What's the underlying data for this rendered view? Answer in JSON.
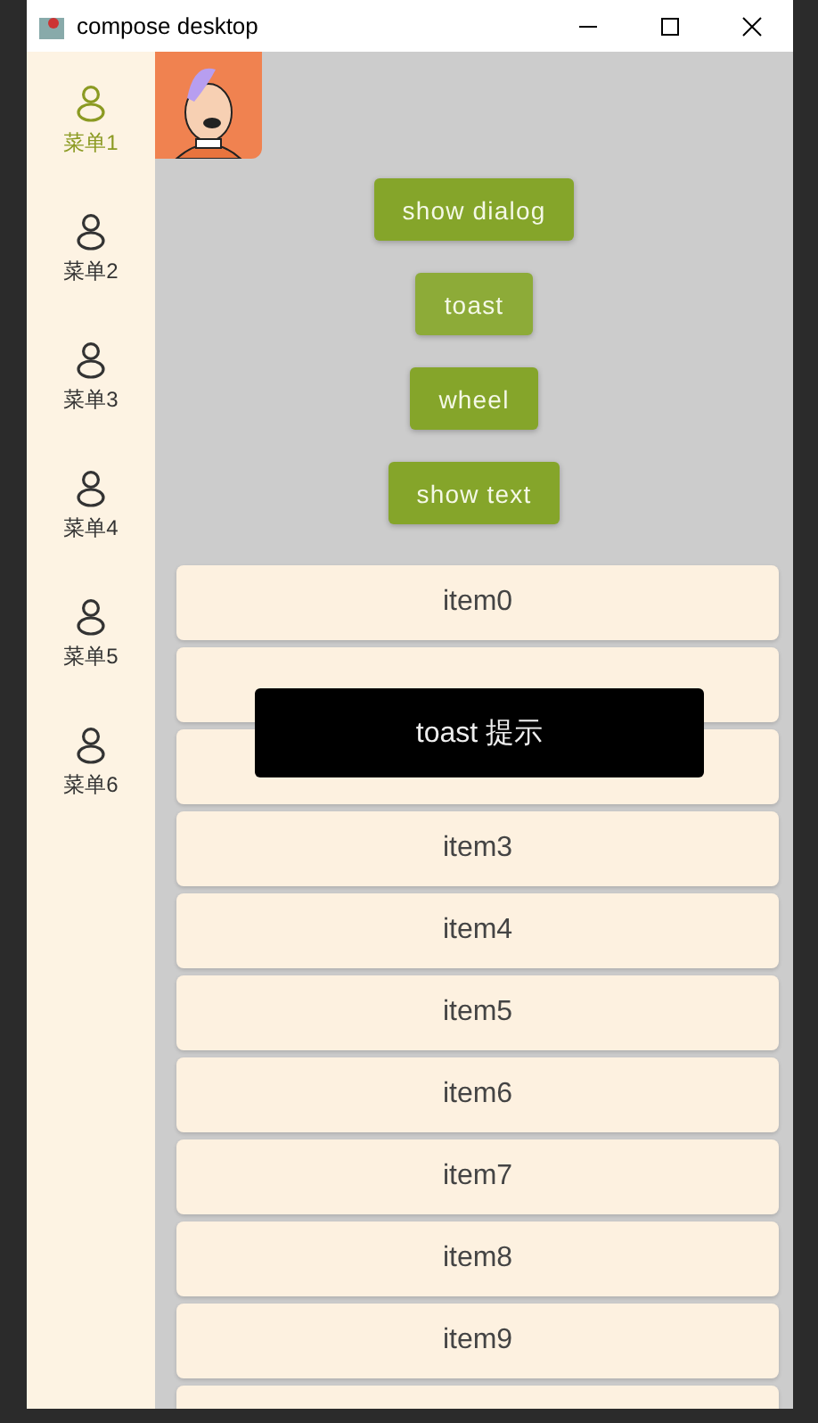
{
  "window": {
    "title": "compose desktop"
  },
  "sidebar": {
    "items": [
      {
        "label": "菜单1",
        "selected": true
      },
      {
        "label": "菜单2",
        "selected": false
      },
      {
        "label": "菜单3",
        "selected": false
      },
      {
        "label": "菜单4",
        "selected": false
      },
      {
        "label": "菜单5",
        "selected": false
      },
      {
        "label": "菜单6",
        "selected": false
      }
    ]
  },
  "buttons": [
    {
      "label": "show dialog",
      "hovered": false
    },
    {
      "label": "toast",
      "hovered": true
    },
    {
      "label": "wheel",
      "hovered": false
    },
    {
      "label": "show text",
      "hovered": false
    }
  ],
  "list": {
    "items": [
      {
        "kind": "labeled",
        "label": "item0"
      },
      {
        "kind": "covered"
      },
      {
        "kind": "covered"
      },
      {
        "kind": "labeled",
        "label": "item3"
      },
      {
        "kind": "labeled",
        "label": "item4"
      },
      {
        "kind": "labeled",
        "label": "item5"
      },
      {
        "kind": "labeled",
        "label": "item6"
      },
      {
        "kind": "labeled",
        "label": "item7"
      },
      {
        "kind": "labeled",
        "label": "item8"
      },
      {
        "kind": "labeled",
        "label": "item9"
      },
      {
        "kind": "covered"
      }
    ]
  },
  "toast": {
    "text": "toast 提示"
  }
}
